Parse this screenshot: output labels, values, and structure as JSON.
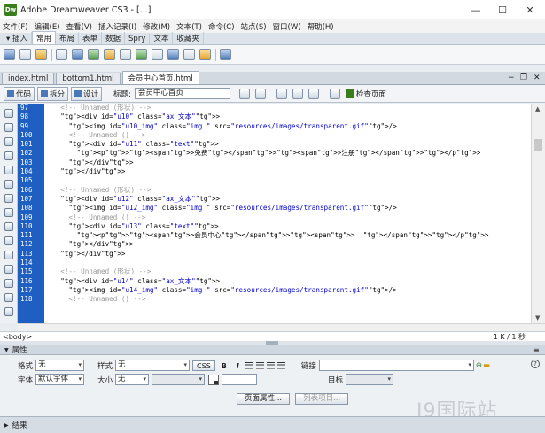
{
  "window": {
    "title": "Adobe Dreamweaver CS3 - [...]",
    "logo": "Dw"
  },
  "menu": [
    "文件(F)",
    "编辑(E)",
    "查看(V)",
    "插入记录(I)",
    "修改(M)",
    "文本(T)",
    "命令(C)",
    "站点(S)",
    "窗口(W)",
    "帮助(H)"
  ],
  "insert_panel": {
    "label": "▾ 插入",
    "tabs": [
      "常用",
      "布局",
      "表单",
      "数据",
      "Spry",
      "文本",
      "收藏夹"
    ],
    "active": "常用"
  },
  "doc_tabs": [
    "index.html",
    "bottom1.html",
    "会员中心首页.html"
  ],
  "doc_tab_active": "会员中心首页.html",
  "doc_toolbar": {
    "code": "代码",
    "split": "拆分",
    "design": "设计",
    "title_label": "标题:",
    "title_value": "会员中心首页",
    "check": "检查页面"
  },
  "code": {
    "line_numbers": [
      "97",
      "98",
      "99",
      "100",
      "101",
      "102",
      "103",
      "104",
      "105",
      "106",
      "107",
      "108",
      "109",
      "110",
      "111",
      "112",
      "113",
      "114",
      "115",
      "116",
      "117",
      "118"
    ],
    "lines": [
      "    <!-- Unnamed (形状) -->",
      "    <div id=\"u10\" class=\"ax_文本\">",
      "      <img id=\"u10_img\" class=\"img \" src=\"resources/images/transparent.gif\"/>",
      "      <!-- Unnamed () -->",
      "      <div id=\"u11\" class=\"text\">",
      "        <p><span>免费</span><span>注册</span></p>",
      "      </div>",
      "    </div>",
      "",
      "    <!-- Unnamed (形状) -->",
      "    <div id=\"u12\" class=\"ax_文本\">",
      "      <img id=\"u12_img\" class=\"img \" src=\"resources/images/transparent.gif\"/>",
      "      <!-- Unnamed () -->",
      "      <div id=\"u13\" class=\"text\">",
      "        <p><span>会员中心</span><span>  </span></p>",
      "      </div>",
      "    </div>",
      "",
      "    <!-- Unnamed (形状) -->",
      "    <div id=\"u14\" class=\"ax_文本\">",
      "      <img id=\"u14_img\" class=\"img \" src=\"resources/images/transparent.gif\"/>",
      "      <!-- Unnamed () -->"
    ]
  },
  "status": {
    "tag": "<body>",
    "size": "1 K / 1 秒"
  },
  "properties": {
    "header": "属性",
    "format_label": "格式",
    "format_value": "无",
    "style_label": "样式",
    "style_value": "无",
    "css_btn": "CSS",
    "bold": "B",
    "italic": "I",
    "link_label": "链接",
    "font_label": "字体",
    "font_value": "默认字体",
    "size_label": "大小",
    "size_value": "无",
    "target_label": "目标",
    "page_props_btn": "页面属性...",
    "list_item_btn": "列表项目..."
  },
  "results": {
    "label": "结果"
  },
  "watermark": "J9国际站"
}
